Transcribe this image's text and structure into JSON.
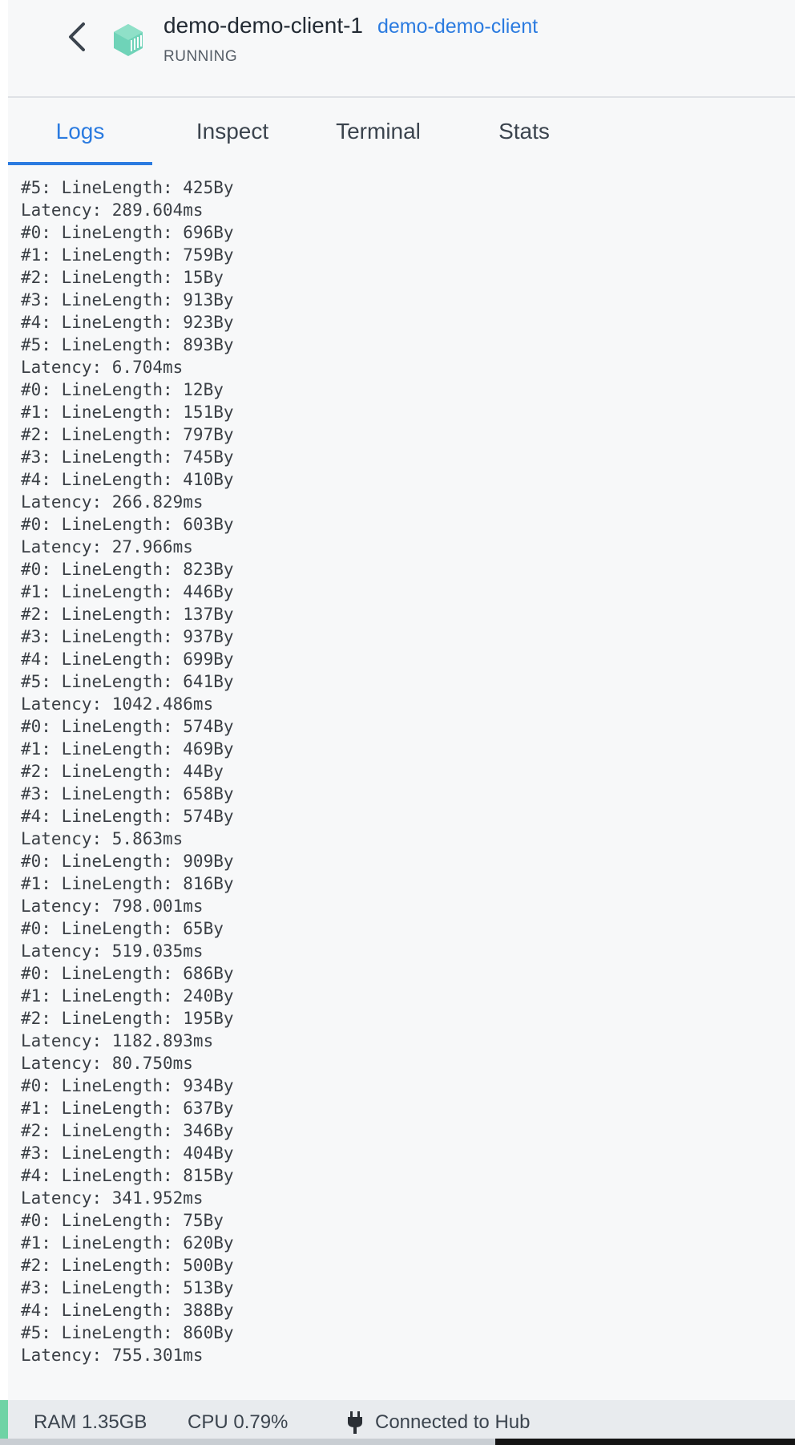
{
  "header": {
    "container_name": "demo-demo-client-1",
    "image_name": "demo-demo-client",
    "status": "RUNNING",
    "back_icon": "chevron-left-icon",
    "container_icon": "container-icon",
    "accent_color": "#2b7be0",
    "container_icon_color": "#6fd3b8"
  },
  "tabs": [
    {
      "label": "Logs",
      "active": true
    },
    {
      "label": "Inspect",
      "active": false
    },
    {
      "label": "Terminal",
      "active": false
    },
    {
      "label": "Stats",
      "active": false
    }
  ],
  "logs": [
    "#5: LineLength: 425By",
    "Latency: 289.604ms",
    "#0: LineLength: 696By",
    "#1: LineLength: 759By",
    "#2: LineLength: 15By",
    "#3: LineLength: 913By",
    "#4: LineLength: 923By",
    "#5: LineLength: 893By",
    "Latency: 6.704ms",
    "#0: LineLength: 12By",
    "#1: LineLength: 151By",
    "#2: LineLength: 797By",
    "#3: LineLength: 745By",
    "#4: LineLength: 410By",
    "Latency: 266.829ms",
    "#0: LineLength: 603By",
    "Latency: 27.966ms",
    "#0: LineLength: 823By",
    "#1: LineLength: 446By",
    "#2: LineLength: 137By",
    "#3: LineLength: 937By",
    "#4: LineLength: 699By",
    "#5: LineLength: 641By",
    "Latency: 1042.486ms",
    "#0: LineLength: 574By",
    "#1: LineLength: 469By",
    "#2: LineLength: 44By",
    "#3: LineLength: 658By",
    "#4: LineLength: 574By",
    "Latency: 5.863ms",
    "#0: LineLength: 909By",
    "#1: LineLength: 816By",
    "Latency: 798.001ms",
    "#0: LineLength: 65By",
    "Latency: 519.035ms",
    "#0: LineLength: 686By",
    "#1: LineLength: 240By",
    "#2: LineLength: 195By",
    "Latency: 1182.893ms",
    "Latency: 80.750ms",
    "#0: LineLength: 934By",
    "#1: LineLength: 637By",
    "#2: LineLength: 346By",
    "#3: LineLength: 404By",
    "#4: LineLength: 815By",
    "Latency: 341.952ms",
    "#0: LineLength: 75By",
    "#1: LineLength: 620By",
    "#2: LineLength: 500By",
    "#3: LineLength: 513By",
    "#4: LineLength: 388By",
    "#5: LineLength: 860By",
    "Latency: 755.301ms"
  ],
  "footer": {
    "ram": "RAM 1.35GB",
    "cpu": "CPU 0.79%",
    "hub_status": "Connected to Hub",
    "hub_icon": "plug-icon",
    "status_color": "#6fd3a5"
  }
}
